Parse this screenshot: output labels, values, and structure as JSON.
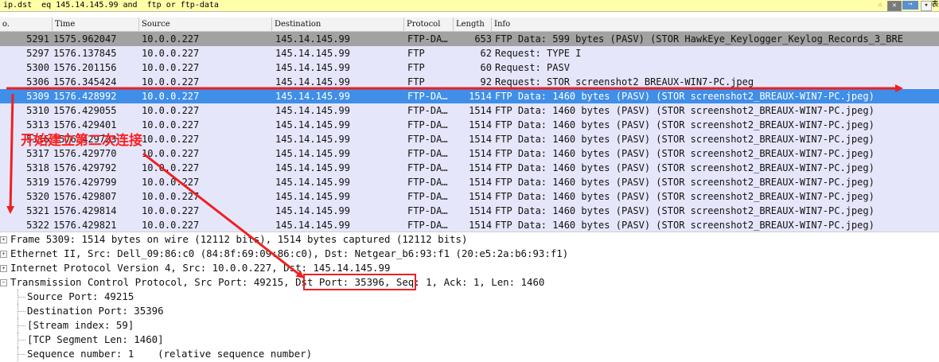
{
  "filter": {
    "text": "ip.dst  eq 145.14.145.99 and  ftp or ftp-data",
    "warn_icon": "warning-icon",
    "clear_icon": "clear-x-icon",
    "apply_icon": "arrow-right-icon",
    "dropdown_icon": "chevron-down-icon",
    "expression_partial": "表"
  },
  "columns": {
    "no": "o.",
    "time": "Time",
    "source": "Source",
    "destination": "Destination",
    "protocol": "Protocol",
    "length": "Length",
    "info": "Info"
  },
  "packets": [
    {
      "no": "5291",
      "time": "1575.962047",
      "src": "10.0.0.227",
      "dst": "145.14.145.99",
      "proto": "FTP-DA…",
      "len": "653",
      "info": "FTP Data: 599 bytes (PASV) (STOR HawkEye_Keylogger_Keylog_Records_3_BRE",
      "state": "gray"
    },
    {
      "no": "5297",
      "time": "1576.137845",
      "src": "10.0.0.227",
      "dst": "145.14.145.99",
      "proto": "FTP",
      "len": "62",
      "info": "Request: TYPE I",
      "state": "lavender"
    },
    {
      "no": "5300",
      "time": "1576.201156",
      "src": "10.0.0.227",
      "dst": "145.14.145.99",
      "proto": "FTP",
      "len": "60",
      "info": "Request: PASV",
      "state": "lavender"
    },
    {
      "no": "5306",
      "time": "1576.345424",
      "src": "10.0.0.227",
      "dst": "145.14.145.99",
      "proto": "FTP",
      "len": "92",
      "info": "Request: STOR screenshot2_BREAUX-WIN7-PC.jpeg",
      "state": "lavender"
    },
    {
      "no": "5309",
      "time": "1576.428992",
      "src": "10.0.0.227",
      "dst": "145.14.145.99",
      "proto": "FTP-DA…",
      "len": "1514",
      "info": "FTP Data: 1460 bytes (PASV) (STOR screenshot2_BREAUX-WIN7-PC.jpeg)",
      "state": "selected"
    },
    {
      "no": "5310",
      "time": "1576.429055",
      "src": "10.0.0.227",
      "dst": "145.14.145.99",
      "proto": "FTP-DA…",
      "len": "1514",
      "info": "FTP Data: 1460 bytes (PASV) (STOR screenshot2_BREAUX-WIN7-PC.jpeg)",
      "state": "lavender"
    },
    {
      "no": "5313",
      "time": "1576.429401",
      "src": "10.0.0.227",
      "dst": "145.14.145.99",
      "proto": "FTP-DA…",
      "len": "1514",
      "info": "FTP Data: 1460 bytes (PASV) (STOR screenshot2_BREAUX-WIN7-PC.jpeg)",
      "state": "lavender"
    },
    {
      "no": "5316",
      "time": "1576.429723",
      "src": "10.0.0.227",
      "dst": "145.14.145.99",
      "proto": "FTP-DA…",
      "len": "1514",
      "info": "FTP Data: 1460 bytes (PASV) (STOR screenshot2_BREAUX-WIN7-PC.jpeg)",
      "state": "lavender"
    },
    {
      "no": "5317",
      "time": "1576.429770",
      "src": "10.0.0.227",
      "dst": "145.14.145.99",
      "proto": "FTP-DA…",
      "len": "1514",
      "info": "FTP Data: 1460 bytes (PASV) (STOR screenshot2_BREAUX-WIN7-PC.jpeg)",
      "state": "lavender"
    },
    {
      "no": "5318",
      "time": "1576.429792",
      "src": "10.0.0.227",
      "dst": "145.14.145.99",
      "proto": "FTP-DA…",
      "len": "1514",
      "info": "FTP Data: 1460 bytes (PASV) (STOR screenshot2_BREAUX-WIN7-PC.jpeg)",
      "state": "lavender"
    },
    {
      "no": "5319",
      "time": "1576.429799",
      "src": "10.0.0.227",
      "dst": "145.14.145.99",
      "proto": "FTP-DA…",
      "len": "1514",
      "info": "FTP Data: 1460 bytes (PASV) (STOR screenshot2_BREAUX-WIN7-PC.jpeg)",
      "state": "lavender"
    },
    {
      "no": "5320",
      "time": "1576.429807",
      "src": "10.0.0.227",
      "dst": "145.14.145.99",
      "proto": "FTP-DA…",
      "len": "1514",
      "info": "FTP Data: 1460 bytes (PASV) (STOR screenshot2_BREAUX-WIN7-PC.jpeg)",
      "state": "lavender"
    },
    {
      "no": "5321",
      "time": "1576.429814",
      "src": "10.0.0.227",
      "dst": "145.14.145.99",
      "proto": "FTP-DA…",
      "len": "1514",
      "info": "FTP Data: 1460 bytes (PASV) (STOR screenshot2_BREAUX-WIN7-PC.jpeg)",
      "state": "lavender"
    },
    {
      "no": "5322",
      "time": "1576.429821",
      "src": "10.0.0.227",
      "dst": "145.14.145.99",
      "proto": "FTP-DA…",
      "len": "1514",
      "info": "FTP Data: 1460 bytes (PASV) (STOR screenshot2_BREAUX-WIN7-PC.jpeg)",
      "state": "lavender"
    }
  ],
  "details": [
    {
      "text": "Frame 5309: 1514 bytes on wire (12112 bits), 1514 bytes captured (12112 bits)",
      "kind": "top",
      "expander": "+"
    },
    {
      "text": "Ethernet II, Src: Dell_09:86:c0 (84:8f:69:09:86:c0), Dst: Netgear_b6:93:f1 (20:e5:2a:b6:93:f1)",
      "kind": "top",
      "expander": "+"
    },
    {
      "text": "Internet Protocol Version 4, Src: 10.0.0.227, Dst: 145.14.145.99",
      "kind": "top",
      "expander": "+"
    },
    {
      "text": "Transmission Control Protocol, Src Port: 49215, Dst Port: 35396, Seq: 1, Ack: 1, Len: 1460",
      "kind": "top",
      "expander": "−"
    },
    {
      "text": "Source Port: 49215",
      "kind": "child"
    },
    {
      "text": "Destination Port: 35396",
      "kind": "child"
    },
    {
      "text": "[Stream index: 59]",
      "kind": "child"
    },
    {
      "text": "[TCP Segment Len: 1460]",
      "kind": "child"
    },
    {
      "text": "Sequence number: 1    (relative sequence number)",
      "kind": "child"
    }
  ],
  "annotation": {
    "text": "开始建立第二次连接",
    "color": "#ff2020"
  },
  "colors": {
    "filter_bg": "#ffffa8",
    "row_lavender": "#e6e6fb",
    "row_gray": "#a2a2a2",
    "row_selected": "#3f8ee8",
    "annotation_red": "#ee2020"
  }
}
